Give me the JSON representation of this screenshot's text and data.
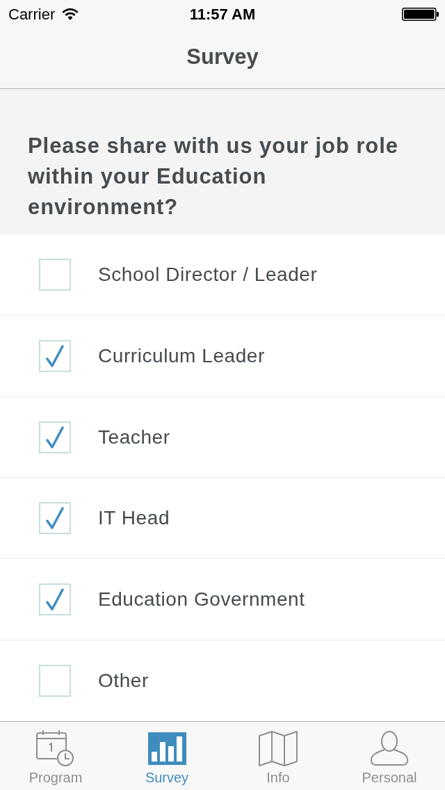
{
  "status_bar": {
    "carrier": "Carrier",
    "time": "11:57 AM"
  },
  "nav_bar": {
    "title": "Survey"
  },
  "question": "Please share with us your job role within your Education environment?",
  "options": [
    {
      "label": "School Director / Leader",
      "checked": false
    },
    {
      "label": "Curriculum Leader",
      "checked": true
    },
    {
      "label": "Teacher",
      "checked": true
    },
    {
      "label": "IT Head",
      "checked": true
    },
    {
      "label": "Education Government",
      "checked": true
    },
    {
      "label": "Other",
      "checked": false
    }
  ],
  "tab_bar": [
    {
      "label": "Program",
      "kind": "calendar",
      "selected": false
    },
    {
      "label": "Survey",
      "kind": "chart",
      "selected": true
    },
    {
      "label": "Info",
      "kind": "map",
      "selected": false
    },
    {
      "label": "Personal",
      "kind": "person",
      "selected": false
    }
  ]
}
